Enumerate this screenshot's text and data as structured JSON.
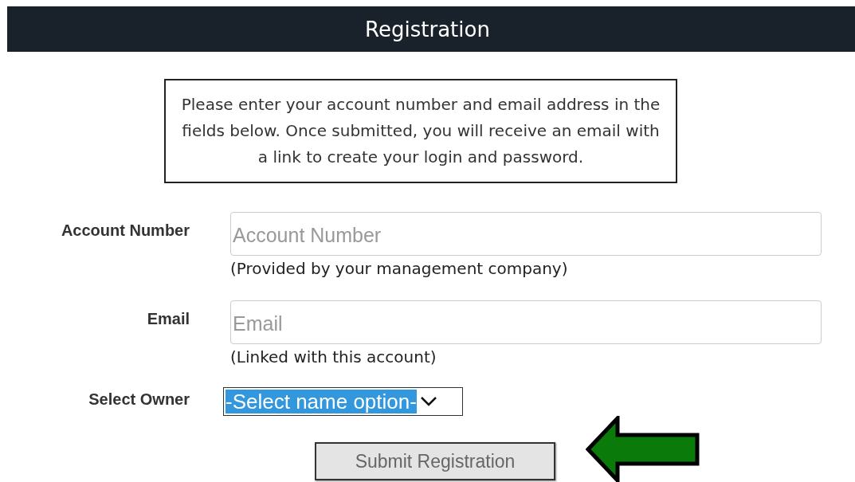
{
  "header": {
    "title": "Registration"
  },
  "notice": "Please enter your account number and email address in the fields below. Once submitted, you will receive an email with a link to create your login and password.",
  "fields": [
    {
      "label": "Account Number",
      "placeholder": "Account Number",
      "hint": "(Provided by your management company)"
    },
    {
      "label": "Email",
      "placeholder": "Email",
      "hint": "(Linked with this account)"
    }
  ],
  "owner_select": {
    "label": "Select Owner",
    "value": "-Select name option-",
    "highlighted": true
  },
  "submit_button": {
    "label": "Submit Registration",
    "disabled": true
  }
}
